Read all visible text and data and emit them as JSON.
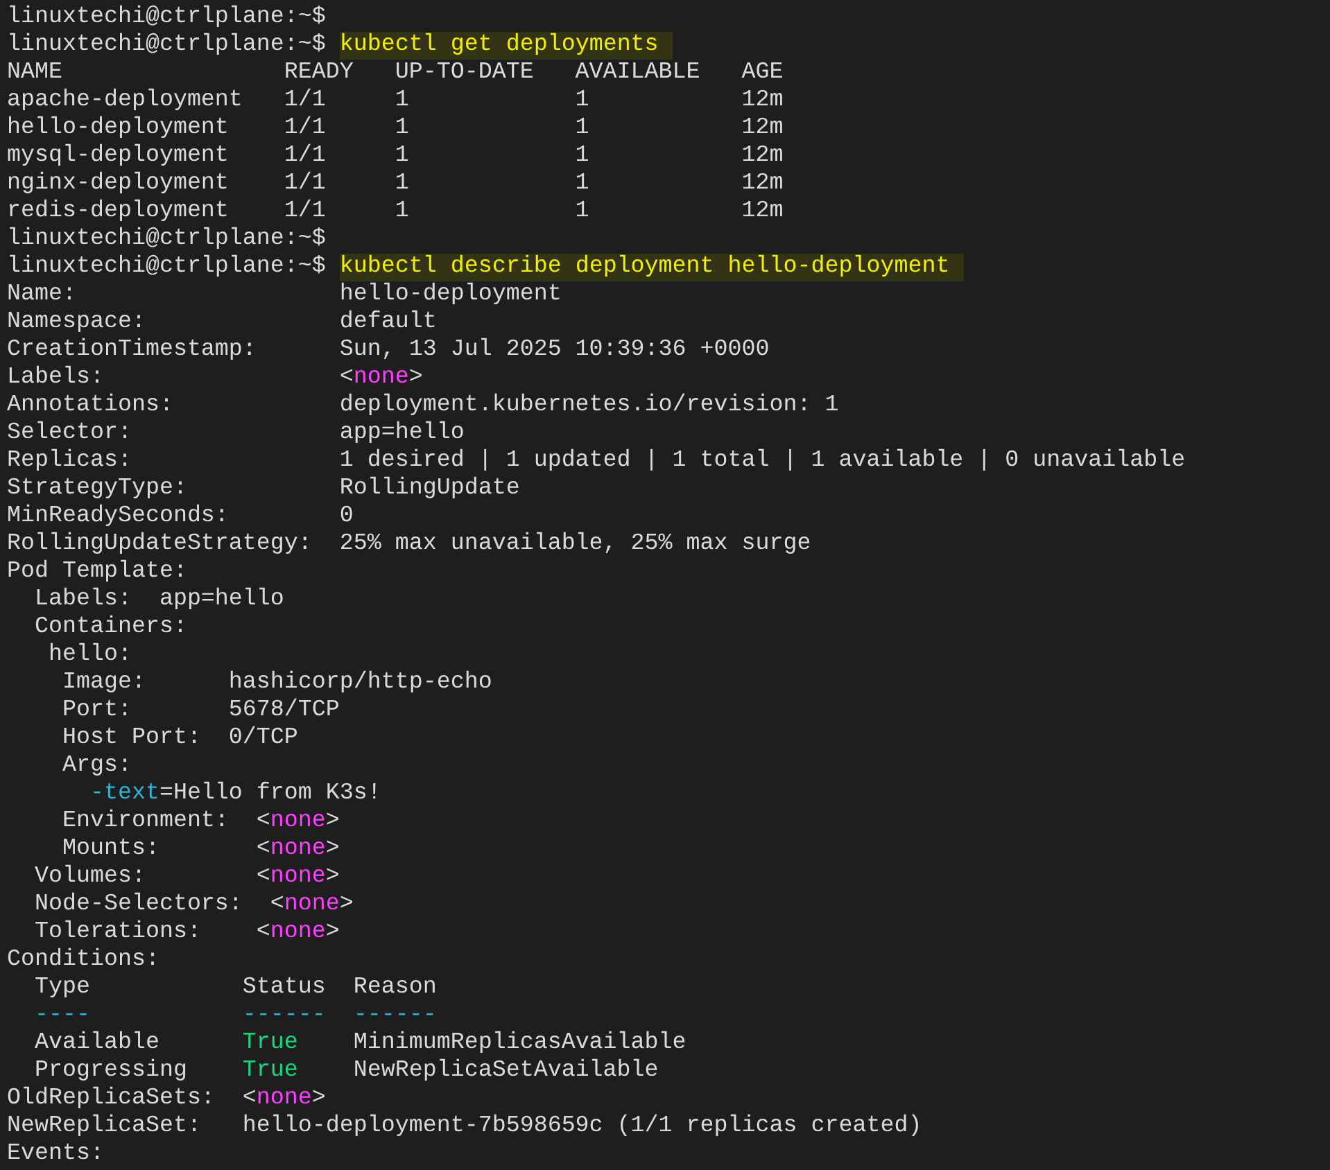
{
  "terminal": {
    "lines": [
      {
        "segments": [
          {
            "kind": "prompt",
            "text": "linuxtechi@ctrlplane:~$"
          }
        ]
      },
      {
        "segments": [
          {
            "kind": "prompt",
            "text": "linuxtechi@ctrlplane:~$"
          },
          {
            "kind": "command",
            "text": "kubectl get deployments"
          }
        ]
      },
      {
        "segments": [
          {
            "kind": "text",
            "text": "NAME                READY   UP-TO-DATE   AVAILABLE   AGE"
          }
        ]
      },
      {
        "segments": [
          {
            "kind": "text",
            "text": "apache-deployment   1/1     1            1           12m"
          }
        ]
      },
      {
        "segments": [
          {
            "kind": "text",
            "text": "hello-deployment    1/1     1            1           12m"
          }
        ]
      },
      {
        "segments": [
          {
            "kind": "text",
            "text": "mysql-deployment    1/1     1            1           12m"
          }
        ]
      },
      {
        "segments": [
          {
            "kind": "text",
            "text": "nginx-deployment    1/1     1            1           12m"
          }
        ]
      },
      {
        "segments": [
          {
            "kind": "text",
            "text": "redis-deployment    1/1     1            1           12m"
          }
        ]
      },
      {
        "segments": [
          {
            "kind": "prompt",
            "text": "linuxtechi@ctrlplane:~$"
          }
        ]
      },
      {
        "segments": [
          {
            "kind": "prompt",
            "text": "linuxtechi@ctrlplane:~$"
          },
          {
            "kind": "command",
            "text": "kubectl describe deployment hello-deployment"
          }
        ]
      },
      {
        "segments": [
          {
            "kind": "text",
            "text": "Name:                   hello-deployment"
          }
        ]
      },
      {
        "segments": [
          {
            "kind": "text",
            "text": "Namespace:              default"
          }
        ]
      },
      {
        "segments": [
          {
            "kind": "text",
            "text": "CreationTimestamp:      Sun, 13 Jul 2025 10:39:36 +0000"
          }
        ]
      },
      {
        "segments": [
          {
            "kind": "text",
            "text": "Labels:                 <"
          },
          {
            "kind": "none",
            "text": "none"
          },
          {
            "kind": "text",
            "text": ">"
          }
        ]
      },
      {
        "segments": [
          {
            "kind": "text",
            "text": "Annotations:            deployment.kubernetes.io/revision: 1"
          }
        ]
      },
      {
        "segments": [
          {
            "kind": "text",
            "text": "Selector:               app=hello"
          }
        ]
      },
      {
        "segments": [
          {
            "kind": "text",
            "text": "Replicas:               1 desired | 1 updated | 1 total | 1 available | 0 unavailable"
          }
        ]
      },
      {
        "segments": [
          {
            "kind": "text",
            "text": "StrategyType:           RollingUpdate"
          }
        ]
      },
      {
        "segments": [
          {
            "kind": "text",
            "text": "MinReadySeconds:        0"
          }
        ]
      },
      {
        "segments": [
          {
            "kind": "text",
            "text": "RollingUpdateStrategy:  25% max unavailable, 25% max surge"
          }
        ]
      },
      {
        "segments": [
          {
            "kind": "text",
            "text": "Pod Template:"
          }
        ]
      },
      {
        "segments": [
          {
            "kind": "text",
            "text": "  Labels:  app=hello"
          }
        ]
      },
      {
        "segments": [
          {
            "kind": "text",
            "text": "  Containers:"
          }
        ]
      },
      {
        "segments": [
          {
            "kind": "text",
            "text": "   hello:"
          }
        ]
      },
      {
        "segments": [
          {
            "kind": "text",
            "text": "    Image:      hashicorp/http-echo"
          }
        ]
      },
      {
        "segments": [
          {
            "kind": "text",
            "text": "    Port:       5678/TCP"
          }
        ]
      },
      {
        "segments": [
          {
            "kind": "text",
            "text": "    Host Port:  0/TCP"
          }
        ]
      },
      {
        "segments": [
          {
            "kind": "text",
            "text": "    Args:"
          }
        ]
      },
      {
        "segments": [
          {
            "kind": "flag",
            "text": "      -text"
          },
          {
            "kind": "text",
            "text": "=Hello from K3s!"
          }
        ]
      },
      {
        "segments": [
          {
            "kind": "text",
            "text": "    Environment:  <"
          },
          {
            "kind": "none",
            "text": "none"
          },
          {
            "kind": "text",
            "text": ">"
          }
        ]
      },
      {
        "segments": [
          {
            "kind": "text",
            "text": "    Mounts:       <"
          },
          {
            "kind": "none",
            "text": "none"
          },
          {
            "kind": "text",
            "text": ">"
          }
        ]
      },
      {
        "segments": [
          {
            "kind": "text",
            "text": "  Volumes:        <"
          },
          {
            "kind": "none",
            "text": "none"
          },
          {
            "kind": "text",
            "text": ">"
          }
        ]
      },
      {
        "segments": [
          {
            "kind": "text",
            "text": "  Node-Selectors:  <"
          },
          {
            "kind": "none",
            "text": "none"
          },
          {
            "kind": "text",
            "text": ">"
          }
        ]
      },
      {
        "segments": [
          {
            "kind": "text",
            "text": "  Tolerations:    <"
          },
          {
            "kind": "none",
            "text": "none"
          },
          {
            "kind": "text",
            "text": ">"
          }
        ]
      },
      {
        "segments": [
          {
            "kind": "text",
            "text": "Conditions:"
          }
        ]
      },
      {
        "segments": [
          {
            "kind": "text",
            "text": "  Type           Status  Reason"
          }
        ]
      },
      {
        "segments": [
          {
            "kind": "rule",
            "text": "  ----           ------  ------"
          }
        ]
      },
      {
        "segments": [
          {
            "kind": "text",
            "text": "  Available      "
          },
          {
            "kind": "ok",
            "text": "True"
          },
          {
            "kind": "text",
            "text": "    MinimumReplicasAvailable"
          }
        ]
      },
      {
        "segments": [
          {
            "kind": "text",
            "text": "  Progressing    "
          },
          {
            "kind": "ok",
            "text": "True"
          },
          {
            "kind": "text",
            "text": "    NewReplicaSetAvailable"
          }
        ]
      },
      {
        "segments": [
          {
            "kind": "text",
            "text": "OldReplicaSets:  <"
          },
          {
            "kind": "none",
            "text": "none"
          },
          {
            "kind": "text",
            "text": ">"
          }
        ]
      },
      {
        "segments": [
          {
            "kind": "text",
            "text": "NewReplicaSet:   hello-deployment-7b598659c (1/1 replicas created)"
          }
        ]
      },
      {
        "segments": [
          {
            "kind": "text",
            "text": "Events:"
          }
        ]
      }
    ]
  }
}
